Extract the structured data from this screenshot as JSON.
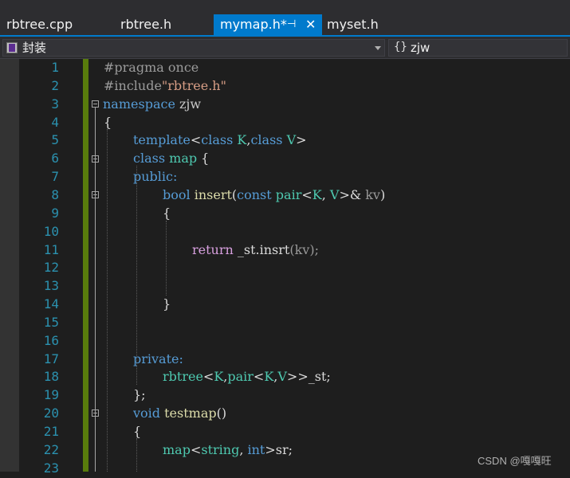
{
  "tabs": [
    {
      "label": "rbtree.cpp",
      "active": false
    },
    {
      "label": "rbtree.h",
      "active": false
    },
    {
      "label": "mymap.h*",
      "active": true
    },
    {
      "label": "myset.h",
      "active": false
    }
  ],
  "nav": {
    "scope": "封装",
    "member": "zjw"
  },
  "lines": [
    "1",
    "2",
    "3",
    "4",
    "5",
    "6",
    "7",
    "8",
    "9",
    "10",
    "11",
    "12",
    "13",
    "14",
    "15",
    "16",
    "17",
    "18",
    "19",
    "20",
    "21",
    "22",
    "23"
  ],
  "code": {
    "pragma": "#pragma once",
    "include_kw": "#include",
    "include_str": "\"rbtree.h\"",
    "namespace_kw": "namespace",
    "namespace_name": "zjw",
    "lbrace": "{",
    "template_kw": "template",
    "lt": "<",
    "gt": ">",
    "class_kw": "class",
    "K": "K",
    "V": "V",
    "comma": ",",
    "map": "map",
    "open_brace_sp": " {",
    "public": "public:",
    "bool_kw": "bool",
    "insert": "insert",
    "lparen": "(",
    "const_kw": "const",
    "pair": "pair",
    "kv": "kv",
    "amp": "&",
    "rparen_sp": ")",
    "return_kw": "return",
    "st_insrt": "_st.insrt",
    "call_kv": "(kv);",
    "rbrace": "}",
    "private": "private:",
    "rbtree": "rbtree",
    "st_decl": "_st;",
    "closing": "};",
    "void_kw": "void",
    "testmap": "testmap",
    "empty_parens": "()",
    "string": "string",
    "int_kw": "int",
    "sr": "sr;"
  },
  "watermark": "CSDN @嘎嘎旺",
  "colors": {
    "accent": "#007acc",
    "change_bar": "#587c0c",
    "line_numbers": "#2b91af"
  }
}
